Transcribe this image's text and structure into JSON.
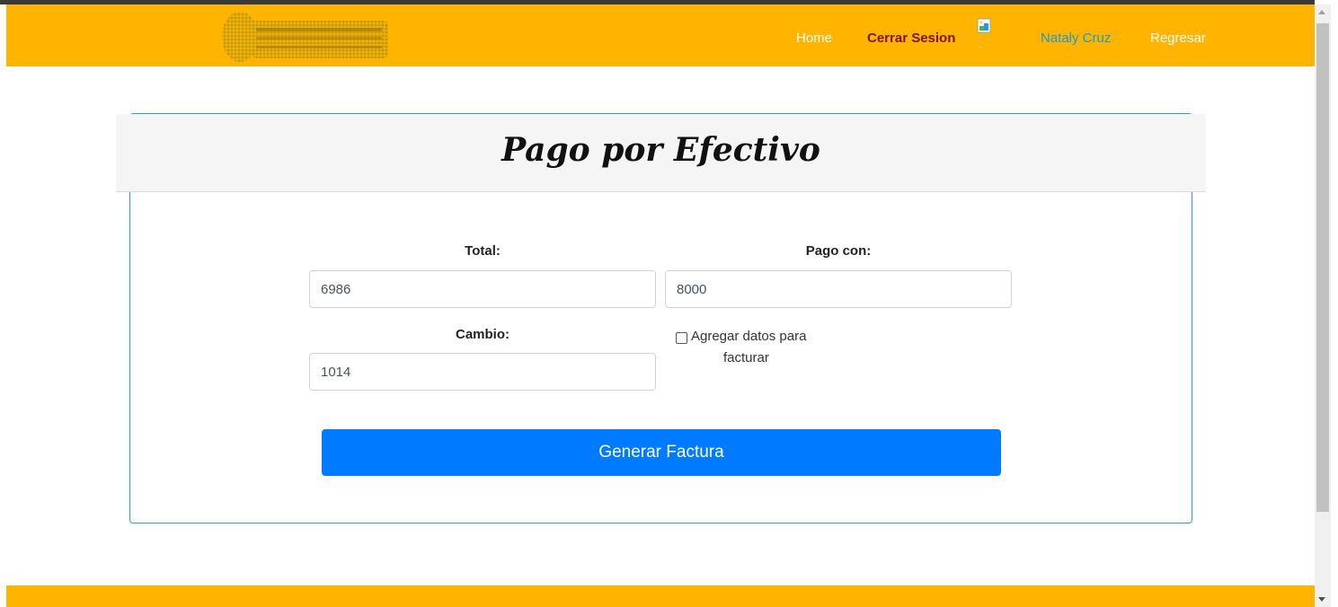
{
  "nav": {
    "home": "Home",
    "logout": "Cerrar Sesion",
    "avatar_icon": "broken-image-icon",
    "user": "Nataly Cruz",
    "back": "Regresar"
  },
  "form": {
    "title": "Pago por Efectivo",
    "total_label": "Total:",
    "total_value": "6986",
    "pago_label": "Pago con:",
    "pago_value": "8000",
    "cambio_label": "Cambio:",
    "cambio_value": "1014",
    "invoice_check_line1": "Agregar datos para",
    "invoice_check_line2": "facturar",
    "invoice_checked": false,
    "submit_label": "Generar Factura"
  },
  "colors": {
    "navbar": "#ffb400",
    "primary_button": "#007bff",
    "card_border": "#2aa2b8",
    "user_link": "#1b9bd1",
    "logout_link": "#7a1400"
  }
}
